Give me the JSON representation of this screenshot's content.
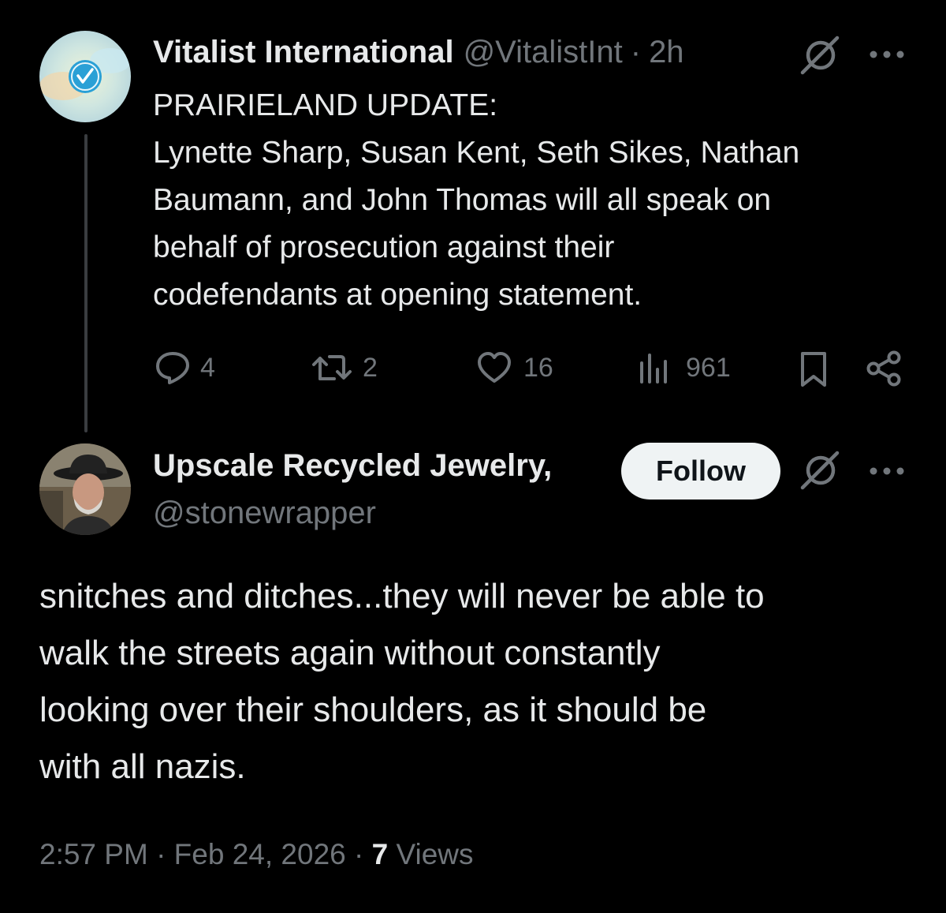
{
  "original_post": {
    "display_name": "Vitalist International",
    "handle": "@VitalistInt",
    "separator": "·",
    "time_ago": "2h",
    "lines": [
      "PRAIRIELAND UPDATE:",
      "Lynette Sharp, Susan Kent, Seth Sikes, Nathan",
      "Baumann, and John Thomas will all speak on",
      "behalf of prosecution against their",
      "codefendants at opening statement."
    ],
    "actions": {
      "replies": "4",
      "reposts": "2",
      "likes": "16",
      "views": "961"
    }
  },
  "reply_post": {
    "display_name": "Upscale Recycled Jewelry,",
    "handle": "@stonewrapper",
    "follow_label": "Follow",
    "lines": [
      "snitches and ditches...they will never be able to",
      "walk the streets again without constantly",
      "looking over their shoulders, as it should be",
      "with all nazis."
    ],
    "timestamp": "2:57 PM · Feb 24, 2026 ·",
    "views_count": "7",
    "views_label": "Views"
  },
  "icons": {
    "grok": "grok-icon",
    "more": "more-icon",
    "reply": "reply-icon",
    "repost": "repost-icon",
    "like": "heart-icon",
    "views": "views-icon",
    "bookmark": "bookmark-icon",
    "share": "share-icon"
  },
  "colors": {
    "background": "#000000",
    "text": "#e7e9ea",
    "muted": "#71767b",
    "follow_bg": "#eff3f4"
  }
}
